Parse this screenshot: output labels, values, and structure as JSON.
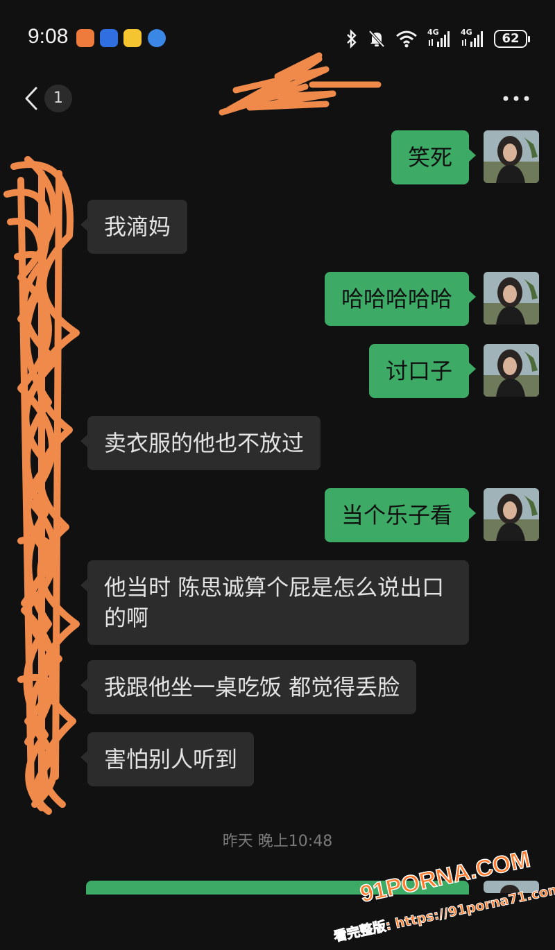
{
  "status_bar": {
    "time": "9:08",
    "battery": "62",
    "network_1": "4G",
    "network_2": "4G"
  },
  "header": {
    "unread_count": "1"
  },
  "messages": [
    {
      "side": "out",
      "text": "笑死"
    },
    {
      "side": "in",
      "text": "我滴妈"
    },
    {
      "side": "out",
      "text": "哈哈哈哈哈"
    },
    {
      "side": "out",
      "text": "讨口子"
    },
    {
      "side": "in",
      "text": "卖衣服的他也不放过"
    },
    {
      "side": "out",
      "text": "当个乐子看"
    },
    {
      "side": "in",
      "text": "他当时  陈思诚算个屁是怎么说出口的啊"
    },
    {
      "side": "in",
      "text": "我跟他坐一桌吃饭 都觉得丢脸"
    },
    {
      "side": "in",
      "text": "害怕别人听到"
    }
  ],
  "timestamp": "昨天 晚上10:48",
  "watermark": {
    "line1": "91PORNA.COM",
    "line2": "看完整版: https://91porna71.com"
  },
  "colors": {
    "background": "#111111",
    "outgoing_bubble": "#3daa66",
    "incoming_bubble": "#2c2c2c",
    "scribble": "#f08a4b"
  },
  "icons": [
    "back-icon",
    "more-icon",
    "bluetooth-icon",
    "mute-icon",
    "wifi-icon",
    "signal-icon",
    "battery-icon",
    "avatar"
  ]
}
